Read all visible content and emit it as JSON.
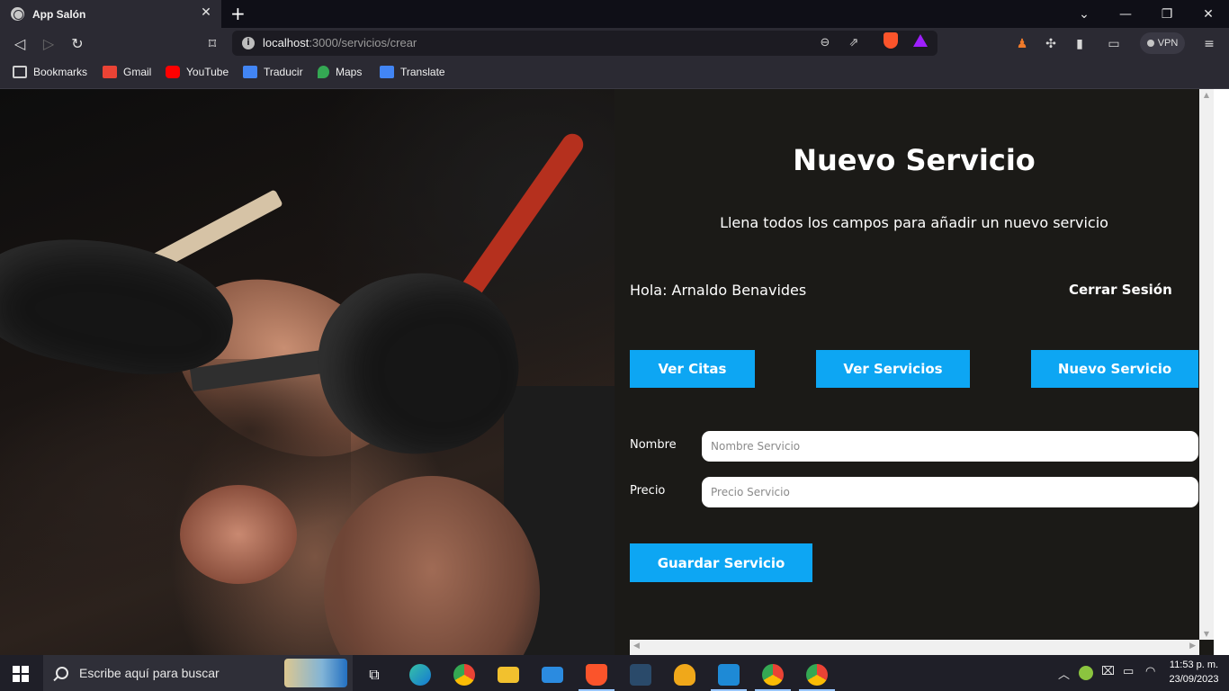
{
  "browser": {
    "tab_title": "App Salón",
    "tab_close": "✕",
    "new_tab": "+",
    "url_host": "localhost",
    "url_path": ":3000/servicios/crear",
    "vpn_label": "VPN",
    "bookmarks": [
      {
        "label": "Bookmarks",
        "icon": "bookmarks-icon",
        "color": "#d0d0d0"
      },
      {
        "label": "Gmail",
        "icon": "gmail-icon",
        "color": "#ea4335"
      },
      {
        "label": "YouTube",
        "icon": "youtube-icon",
        "color": "#ff0000"
      },
      {
        "label": "Traducir",
        "icon": "google-translate-icon",
        "color": "#4285f4"
      },
      {
        "label": "Maps",
        "icon": "google-maps-icon",
        "color": "#34a853"
      },
      {
        "label": "Translate",
        "icon": "google-translate-icon",
        "color": "#4285f4"
      }
    ]
  },
  "page": {
    "title": "Nuevo Servicio",
    "subtitle": "Llena todos los campos para añadir un nuevo servicio",
    "greeting": "Hola: Arnaldo Benavides",
    "logout_label": "Cerrar Sesión",
    "nav_buttons": [
      "Ver Citas",
      "Ver Servicios",
      "Nuevo Servicio"
    ],
    "form": {
      "nombre_label": "Nombre",
      "nombre_placeholder": "Nombre Servicio",
      "nombre_value": "",
      "precio_label": "Precio",
      "precio_placeholder": "Precio Servicio",
      "precio_value": "",
      "submit_label": "Guardar Servicio"
    },
    "accent_color": "#0da6f3",
    "panel_background": "#1b1a17"
  },
  "taskbar": {
    "search_placeholder": "Escribe aquí para buscar",
    "time": "11:53 p. m.",
    "date": "23/09/2023",
    "apps": [
      "task-view-icon",
      "edge-icon",
      "chrome-icon",
      "file-explorer-icon",
      "mail-icon",
      "brave-icon",
      "mysql-workbench-icon",
      "tableplus-icon",
      "vscode-icon",
      "chrome-profile-icon",
      "chrome-profile-icon"
    ]
  }
}
